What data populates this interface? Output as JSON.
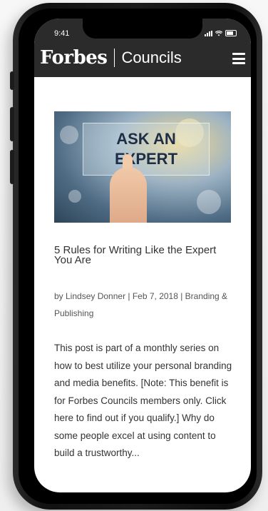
{
  "status_bar": {
    "time": "9:41"
  },
  "header": {
    "logo_brand": "Forbes",
    "logo_product": "Councils",
    "menu_icon": "hamburger-menu-icon"
  },
  "article": {
    "image_text": "ASK AN\nEXPERT",
    "title": "5 Rules for Writing Like the Expert You Are",
    "meta": "by Lindsey Donner | Feb 7, 2018 | Branding & Publishing",
    "excerpt": "This post is part of a monthly series on how to best utilize your personal branding and media benefits. [Note: This benefit is for Forbes Councils members only. Click here to find out if you qualify.] Why do some people excel at using content to build a trustworthy..."
  },
  "colors": {
    "header_bg": "#2b2b2b",
    "body_bg": "#ffffff",
    "text": "#333333"
  }
}
